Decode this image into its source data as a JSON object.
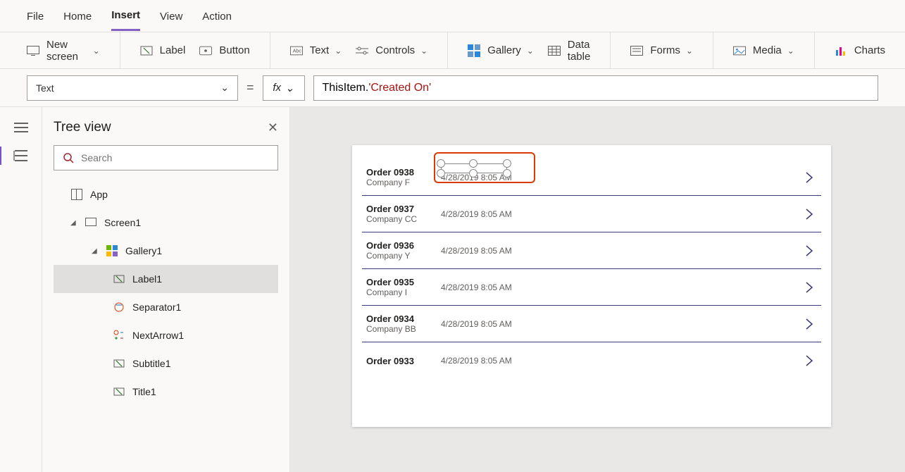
{
  "menu": {
    "file": "File",
    "home": "Home",
    "insert": "Insert",
    "view": "View",
    "action": "Action"
  },
  "ribbon": {
    "new_screen": "New screen",
    "label": "Label",
    "button": "Button",
    "text": "Text",
    "controls": "Controls",
    "gallery": "Gallery",
    "data_table": "Data table",
    "forms": "Forms",
    "media": "Media",
    "charts": "Charts"
  },
  "formula": {
    "property": "Text",
    "equals": "=",
    "fx": "fx",
    "obj": "ThisItem",
    "dot": ".",
    "string": "'Created On'"
  },
  "sidepanel": {
    "title": "Tree view",
    "search_placeholder": "Search"
  },
  "tree": {
    "app": "App",
    "screen": "Screen1",
    "gallery": "Gallery1",
    "label": "Label1",
    "separator": "Separator1",
    "nextarrow": "NextArrow1",
    "subtitle": "Subtitle1",
    "titlectl": "Title1"
  },
  "orders": [
    {
      "title": "Order 0938",
      "subtitle": "Company F",
      "date": "4/28/2019 8:05 AM"
    },
    {
      "title": "Order 0937",
      "subtitle": "Company CC",
      "date": "4/28/2019 8:05 AM"
    },
    {
      "title": "Order 0936",
      "subtitle": "Company Y",
      "date": "4/28/2019 8:05 AM"
    },
    {
      "title": "Order 0935",
      "subtitle": "Company I",
      "date": "4/28/2019 8:05 AM"
    },
    {
      "title": "Order 0934",
      "subtitle": "Company BB",
      "date": "4/28/2019 8:05 AM"
    },
    {
      "title": "Order 0933",
      "subtitle": "",
      "date": "4/28/2019 8:05 AM"
    }
  ]
}
